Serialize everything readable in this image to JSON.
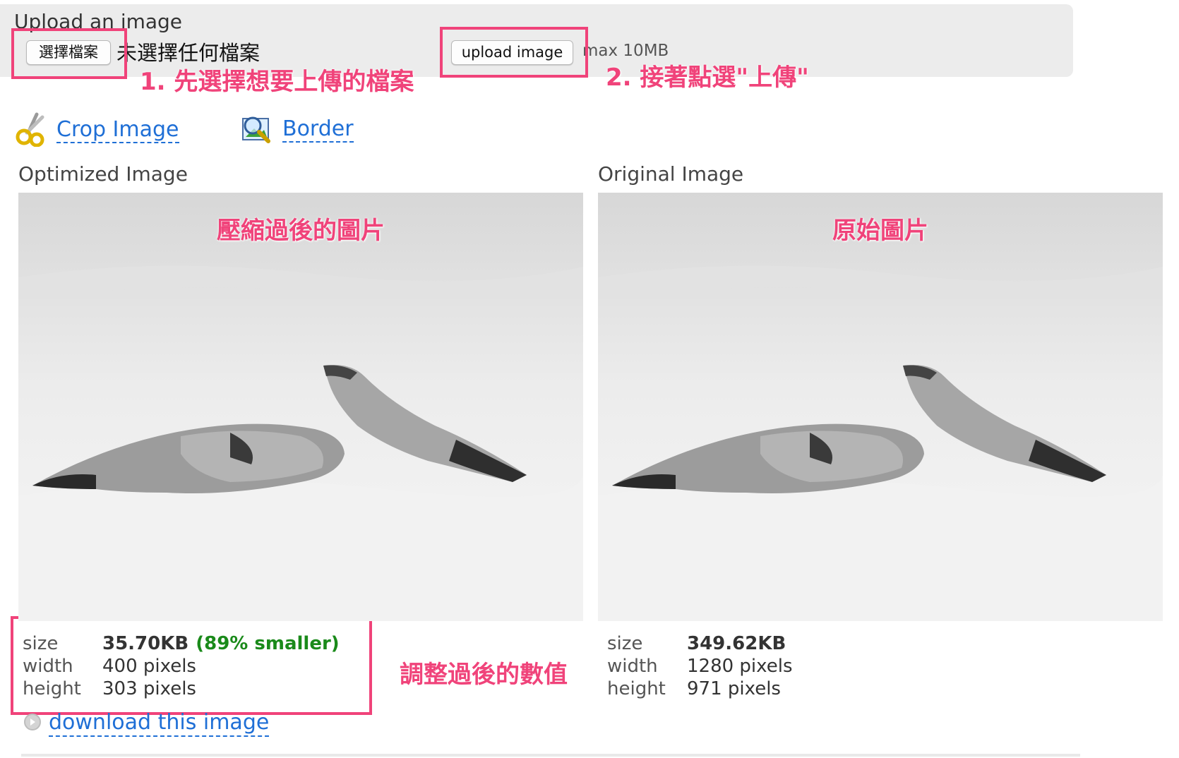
{
  "upload": {
    "title": "Upload an image",
    "choose_button": "選擇檔案",
    "no_file_text": "未選擇任何檔案",
    "upload_button": "upload image",
    "max_size": "max 10MB"
  },
  "annotations": {
    "step1": "1. 先選擇想要上傳的檔案",
    "step2": "2. 接著點選\"上傳\"",
    "optimized_caption": "壓縮過後的圖片",
    "original_caption": "原始圖片",
    "adjusted_values": "調整過後的數值"
  },
  "tools": {
    "crop_label": "Crop Image",
    "border_label": "Border"
  },
  "optimized": {
    "label": "Optimized Image",
    "size_key": "size",
    "size_value": "35.70KB",
    "size_note": "(89% smaller)",
    "width_key": "width",
    "width_value": "400 pixels",
    "height_key": "height",
    "height_value": "303 pixels",
    "download_label": "download this image"
  },
  "original": {
    "label": "Original Image",
    "size_key": "size",
    "size_value": "349.62KB",
    "width_key": "width",
    "width_value": "1280 pixels",
    "height_key": "height",
    "height_value": "971 pixels"
  },
  "colors": {
    "annotation": "#f0437a",
    "link": "#1f6fd6",
    "savings": "#1a8a1a"
  },
  "icons": {
    "crop": "scissors-icon",
    "border": "magnifier-image-icon",
    "download": "arrow-circle-icon"
  }
}
